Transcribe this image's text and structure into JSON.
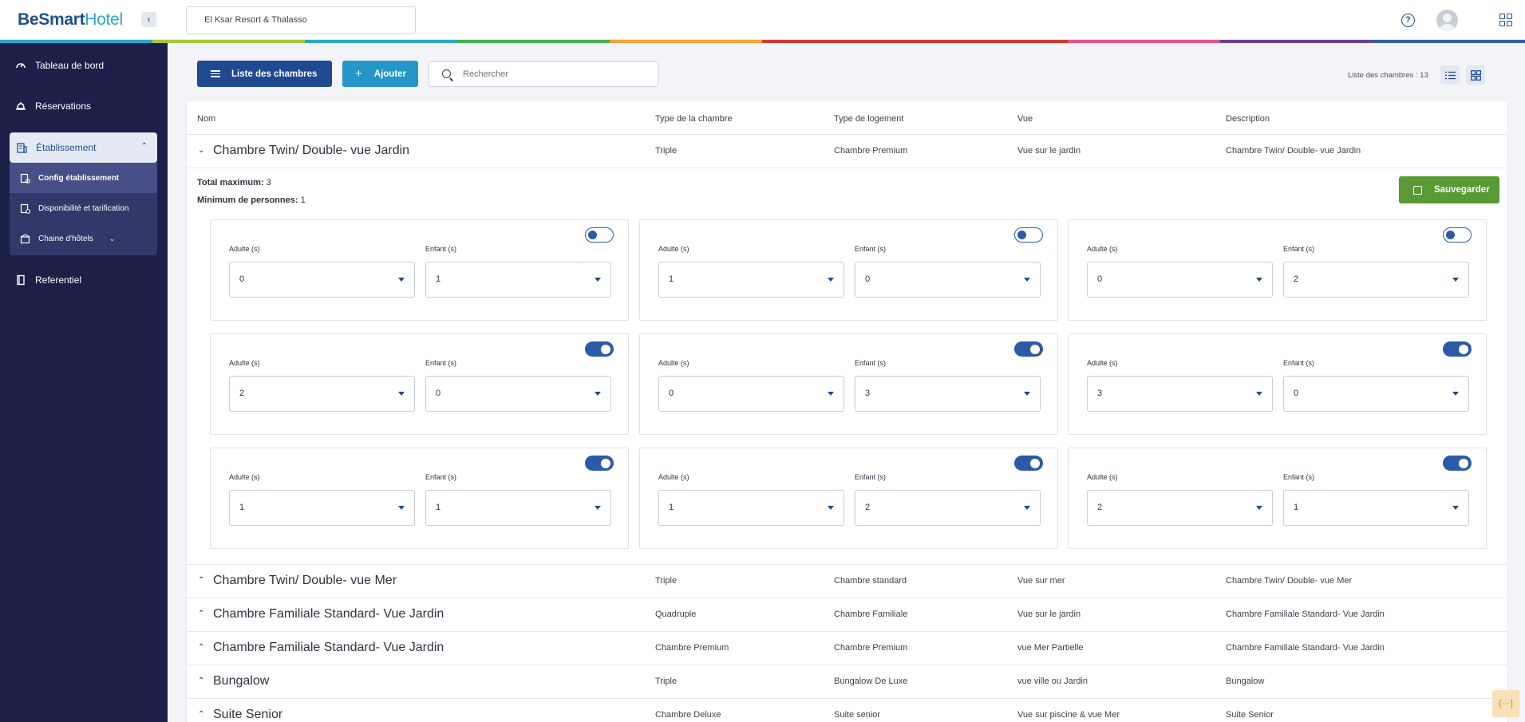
{
  "brand": {
    "part1": "BeSmart",
    "part2": "Hotel"
  },
  "hotel_select": {
    "value": "El Ksar Resort & Thalasso"
  },
  "topbar_icons": [
    "help-icon",
    "avatar",
    "apps-icon"
  ],
  "color_strip": [
    "#2aa6c9",
    "#a7c83a",
    "#2aa6c9",
    "#43b04a",
    "#f2a33a",
    "#d23a2d",
    "#d23a2d",
    "#e6578a",
    "#6b3fa0",
    "#2f5fa8"
  ],
  "sidebar": {
    "items": [
      {
        "label": "Tableau de bord",
        "icon": "dashboard-icon"
      },
      {
        "label": "Réservations",
        "icon": "bell-icon"
      },
      {
        "label": "Referentiel",
        "icon": "book-icon"
      }
    ],
    "etablissement": {
      "label": "Établissement",
      "icon": "building-icon",
      "sub": [
        {
          "label": "Config établissement",
          "icon": "config-icon",
          "active": true
        },
        {
          "label": "Disponibilité et tarification",
          "icon": "pricing-icon",
          "active": false
        },
        {
          "label": "Chaine d'hôtels",
          "icon": "hotel-chain-icon",
          "active": false
        }
      ]
    }
  },
  "toolbar": {
    "list_label": "Liste des chambres",
    "add_label": "Ajouter",
    "search_placeholder": "Rechercher",
    "count_label": "Liste des chambres : 13"
  },
  "table": {
    "headers": [
      "Nom",
      "Type de la chambre",
      "Type de logement",
      "Vue",
      "Description"
    ],
    "rows": [
      {
        "name": "Chambre Twin/ Double- vue Jardin",
        "type": "Triple",
        "logement": "Chambre Premium",
        "vue": "Vue sur le jardin",
        "description": "Chambre Twin/ Double- vue Jardin",
        "expanded": true
      },
      {
        "name": "Chambre Twin/ Double- vue Mer",
        "type": "Triple",
        "logement": "Chambre standard",
        "vue": "Vue sur mer",
        "description": "Chambre Twin/ Double- vue Mer",
        "expanded": false
      },
      {
        "name": "Chambre Familiale Standard- Vue Jardin",
        "type": "Quadruple",
        "logement": "Chambre Familiale",
        "vue": "Vue sur le jardin",
        "description": "Chambre Familiale Standard- Vue Jardin",
        "expanded": false
      },
      {
        "name": "Chambre Familiale Standard- Vue Jardin",
        "type": "Chambre Premium",
        "logement": "Chambre Premium",
        "vue": "vue Mer Partielle",
        "description": "Chambre Familiale Standard- Vue Jardin",
        "expanded": false
      },
      {
        "name": "Bungalow",
        "type": "Triple",
        "logement": "Bungalow De Luxe",
        "vue": "vue ville ou Jardin",
        "description": "Bungalow",
        "expanded": false
      },
      {
        "name": "Suite Senior",
        "type": "Chambre Deluxe",
        "logement": "Suite senior",
        "vue": "Vue sur piscine & vue Mer",
        "description": "Suite Senior",
        "expanded": false
      }
    ]
  },
  "detail": {
    "total_max_label": "Total maximum:",
    "total_max_value": "3",
    "min_persons_label": "Minimum de personnes:",
    "min_persons_value": "1",
    "save_label": "Sauvegarder",
    "adult_label": "Adulte (s)",
    "child_label": "Enfant (s)",
    "occupancies": [
      {
        "adults": "0",
        "children": "1",
        "enabled": false
      },
      {
        "adults": "1",
        "children": "0",
        "enabled": false
      },
      {
        "adults": "0",
        "children": "2",
        "enabled": false
      },
      {
        "adults": "2",
        "children": "0",
        "enabled": true
      },
      {
        "adults": "0",
        "children": "3",
        "enabled": true
      },
      {
        "adults": "3",
        "children": "0",
        "enabled": true
      },
      {
        "adults": "1",
        "children": "1",
        "enabled": true
      },
      {
        "adults": "1",
        "children": "2",
        "enabled": true
      },
      {
        "adults": "2",
        "children": "1",
        "enabled": true
      }
    ]
  },
  "float_button": {
    "label": "{···}"
  }
}
